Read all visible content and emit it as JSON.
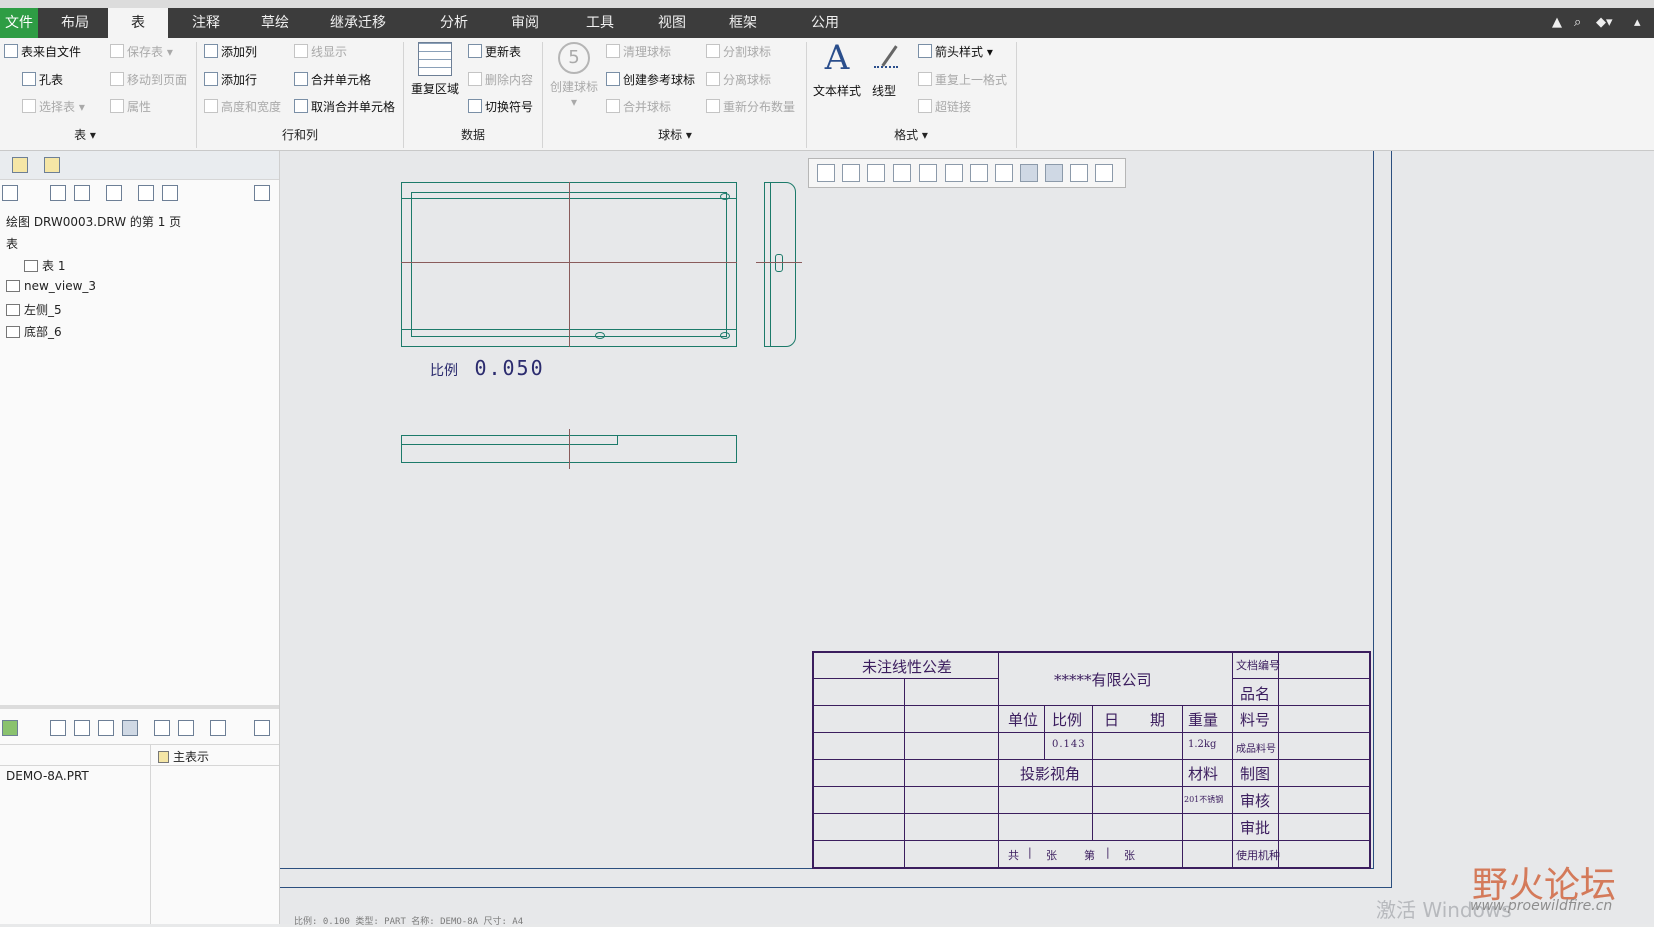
{
  "tabs": [
    "文件",
    "布局",
    "表",
    "注释",
    "草绘",
    "继承迁移",
    "分析",
    "审阅",
    "工具",
    "视图",
    "框架",
    "公用"
  ],
  "active_tab": "表",
  "ribbon": {
    "table_group": {
      "items": [
        "表来自文件",
        "保存表",
        "孔表",
        "移动到页面",
        "选择表",
        "属性"
      ],
      "label": "表"
    },
    "rowcol_group": {
      "items": [
        "添加列",
        "线显示",
        "添加行",
        "合并单元格",
        "高度和宽度",
        "取消合并单元格"
      ],
      "label": "行和列"
    },
    "data_group": {
      "big": "重复区域",
      "items": [
        "更新表",
        "删除内容",
        "切换符号"
      ],
      "label": "数据"
    },
    "balloon_group": {
      "big": "创建球标",
      "big_icon_text": "5",
      "items": [
        "清理球标",
        "分割球标",
        "创建参考球标",
        "分离球标",
        "合并球标",
        "重新分布数量"
      ],
      "label": "球标"
    },
    "format_group": {
      "big1": "文本样式",
      "big1_icon_text": "A",
      "big2": "线型",
      "items": [
        "箭头样式",
        "重复上一格式",
        "超链接"
      ],
      "label": "格式"
    }
  },
  "left_panel": {
    "tree_title": "绘图 DRW0003.DRW 的第 1 页",
    "tree_items": [
      "表",
      "表 1",
      "new_view_3",
      "左侧_5",
      "底部_6"
    ],
    "model_column": "主表示",
    "model_name": "DEMO-8A.PRT"
  },
  "drawing": {
    "scale_label": "比例",
    "scale_value": "0.050"
  },
  "title_block": {
    "tolerance": "未注线性公差",
    "company": "*****有限公司",
    "doc_no_label": "文档编号",
    "name_label": "品名",
    "unit": "单位",
    "scale": "比例",
    "date_a": "日",
    "date_b": "期",
    "weight": "重量",
    "part_no": "料号",
    "scale_value": "0.143",
    "weight_value": "1.2kg",
    "finished_part_no": "成品料号",
    "projection": "投影视角",
    "material": "材料",
    "drawn": "制图",
    "material_value": "201不锈钢",
    "checked": "审核",
    "approved": "审批",
    "sheets_a": "共",
    "sheets_b": "张",
    "sheets_c": "第",
    "sheets_d": "张",
    "usage": "使用机种"
  },
  "status_bar": "比例: 0.100   类型: PART   名称: DEMO-8A   尺寸: A4",
  "watermark": {
    "activate": "激活 Windows",
    "logo": "野火论坛",
    "url": "www.proewildfire.cn"
  },
  "colors": {
    "tab_bar": "#3c3c3c",
    "file_tab": "#2e9d44",
    "drawing_lines": "#1c7a6a",
    "title_block": "#3b1d5e"
  }
}
